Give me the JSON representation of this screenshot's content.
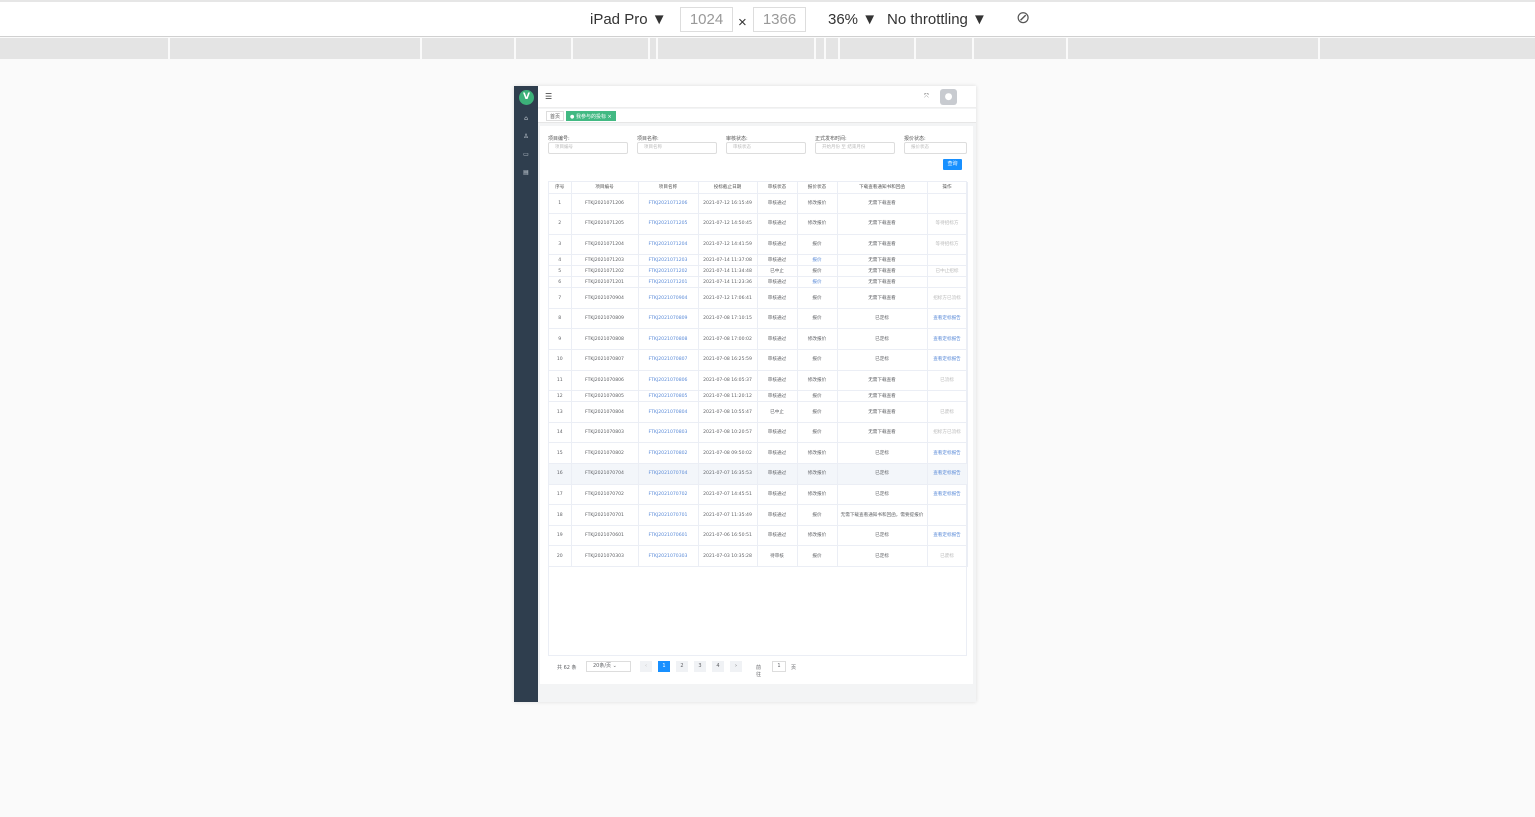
{
  "devtools": {
    "device": "iPad Pro",
    "width": "1024",
    "height": "1366",
    "zoom": "36%",
    "throttling": "No throttling"
  },
  "app": {
    "logo": "V",
    "tabs": [
      {
        "label": "首页"
      },
      {
        "label": "我参与的投标"
      }
    ]
  },
  "filters": [
    {
      "label": "项目编号:",
      "placeholder": "项目编号"
    },
    {
      "label": "项目名称:",
      "placeholder": "项目名称"
    },
    {
      "label": "审核状态:",
      "placeholder": "审核状态"
    },
    {
      "label": "正式发布时间:",
      "placeholder": "开始月份  至  结束月份"
    },
    {
      "label": "报价状态:",
      "placeholder": "报价状态"
    }
  ],
  "query_label": "查询",
  "table": {
    "headers": [
      "序号",
      "项目编号",
      "项目名称",
      "投标截止日期",
      "审核状态",
      "报价状态",
      "下载查看通知书和回函",
      "操作"
    ],
    "rows": [
      [
        "1",
        "FTKJ2021071206",
        "FTKJ2021071206",
        "2021-07-12 16:15:49",
        "审核通过",
        "修改报价",
        "无需下载查看",
        ""
      ],
      [
        "2",
        "FTKJ2021071205",
        "FTKJ2021071205",
        "2021-07-12 14:50:45",
        "审核通过",
        "修改报价",
        "无需下载查看",
        "等待招标方"
      ],
      [
        "3",
        "FTKJ2021071204",
        "FTKJ2021071204",
        "2021-07-12 14:41:59",
        "审核通过",
        "报价",
        "无需下载查看",
        "等待招标方"
      ],
      [
        "4",
        "FTKJ2021071203",
        "FTKJ2021071203",
        "2021-07-14 11:37:08",
        "审核通过",
        "报价",
        "无需下载查看",
        ""
      ],
      [
        "5",
        "FTKJ2021071202",
        "FTKJ2021071202",
        "2021-07-14 11:34:48",
        "已中止",
        "报价",
        "无需下载查看",
        "已中止招标"
      ],
      [
        "6",
        "FTKJ2021071201",
        "FTKJ2021071201",
        "2021-07-14 11:23:36",
        "审核通过",
        "报价",
        "无需下载查看",
        ""
      ],
      [
        "7",
        "FTKJ2021070904",
        "FTKJ2021070904",
        "2021-07-12 17:06:41",
        "审核通过",
        "报价",
        "无需下载查看",
        "招标方已流标"
      ],
      [
        "8",
        "FTKJ2021070809",
        "FTKJ2021070809",
        "2021-07-08 17:10:15",
        "审核通过",
        "报价",
        "已定标",
        "查看定标报告"
      ],
      [
        "9",
        "FTKJ2021070808",
        "FTKJ2021070808",
        "2021-07-08 17:00:02",
        "审核通过",
        "修改报价",
        "已定标",
        "查看定标报告"
      ],
      [
        "10",
        "FTKJ2021070807",
        "FTKJ2021070807",
        "2021-07-08 16:25:59",
        "审核通过",
        "报价",
        "已定标",
        "查看定标报告"
      ],
      [
        "11",
        "FTKJ2021070806",
        "FTKJ2021070806",
        "2021-07-08 16:05:37",
        "审核通过",
        "修改报价",
        "无需下载查看",
        "已流标"
      ],
      [
        "12",
        "FTKJ2021070805",
        "FTKJ2021070805",
        "2021-07-08 11:20:12",
        "审核通过",
        "报价",
        "无需下载查看",
        ""
      ],
      [
        "13",
        "FTKJ2021070804",
        "FTKJ2021070804",
        "2021-07-08 10:55:47",
        "已中止",
        "报价",
        "无需下载查看",
        "已废标"
      ],
      [
        "14",
        "FTKJ2021070803",
        "FTKJ2021070803",
        "2021-07-08 10:20:57",
        "审核通过",
        "报价",
        "无需下载查看",
        "招标方已流标"
      ],
      [
        "15",
        "FTKJ2021070802",
        "FTKJ2021070802",
        "2021-07-08 09:50:02",
        "审核通过",
        "修改报价",
        "已定标",
        "查看定标报告"
      ],
      [
        "16",
        "FTKJ2021070704",
        "FTKJ2021070704",
        "2021-07-07 16:35:53",
        "审核通过",
        "修改报价",
        "已定标",
        "查看定标报告"
      ],
      [
        "17",
        "FTKJ2021070702",
        "FTKJ2021070702",
        "2021-07-07 14:45:51",
        "审核通过",
        "修改报价",
        "已定标",
        "查看定标报告"
      ],
      [
        "18",
        "FTKJ2021070701",
        "FTKJ2021070701",
        "2021-07-07 11:35:49",
        "审核通过",
        "报价",
        "无需下载查看通知书和回函，需要提报价",
        ""
      ],
      [
        "19",
        "FTKJ2021070601",
        "FTKJ2021070601",
        "2021-07-06 16:50:51",
        "审核通过",
        "修改报价",
        "已定标",
        "查看定标报告"
      ],
      [
        "20",
        "FTKJ2021070303",
        "FTKJ2021070303",
        "2021-07-03 10:35:28",
        "待审核",
        "报价",
        "已定标",
        "已废标"
      ]
    ]
  },
  "pagination": {
    "total": "共 62 条",
    "page_size": "20条/页",
    "pages": [
      "1",
      "2",
      "3",
      "4"
    ],
    "current": "1",
    "goto_label": "前往",
    "goto_value": "1",
    "page_unit": "页"
  }
}
